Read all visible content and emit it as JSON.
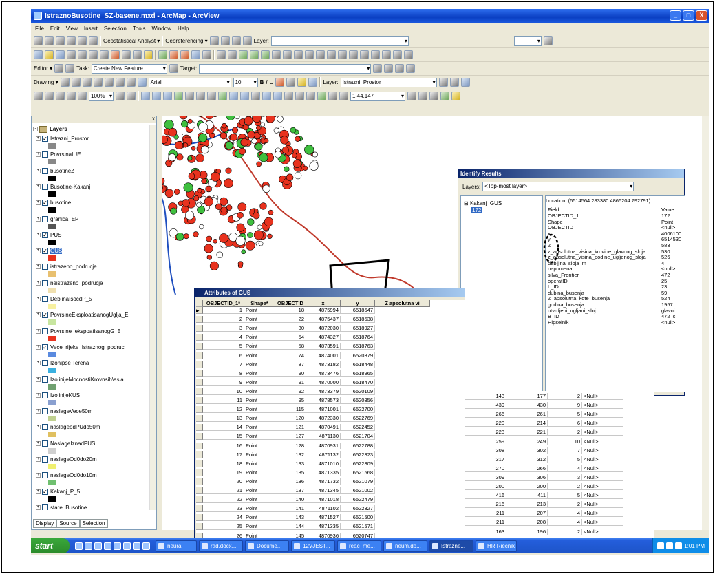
{
  "window": {
    "title": "IstraznoBusotine_SZ-basene.mxd - ArcMap - ArcView",
    "controls": [
      "_",
      "□",
      "X"
    ]
  },
  "menu": [
    "File",
    "Edit",
    "View",
    "Insert",
    "Selection",
    "Tools",
    "Window",
    "Help"
  ],
  "toolbar1": {
    "geostat": "Geostatistical Analyst ▾",
    "georef": "Georeferencing ▾",
    "layer_label": "Layer:"
  },
  "editor": {
    "label": "Editor ▾",
    "task_label": "Task:",
    "task_value": "Create New Feature",
    "target_label": "Target:"
  },
  "drawing": {
    "label": "Drawing ▾",
    "font": "Arial",
    "size": "10",
    "bold": "B",
    "italic": "I",
    "underline": "U",
    "layer_label": "Layer:",
    "layer_value": "Istrazni_Prostor"
  },
  "tools": {
    "scale": "1:44,147",
    "zoom": "100%"
  },
  "toc": {
    "root": "Layers",
    "layers": [
      {
        "name": "Istrazni_Prostor",
        "checked": true
      },
      {
        "name": "PovrsinaIUE",
        "checked": false
      },
      {
        "name": "busotineZ",
        "checked": false
      },
      {
        "name": "Busotine-Kakanj",
        "checked": false
      },
      {
        "name": "busotine",
        "checked": true
      },
      {
        "name": "granica_EP",
        "checked": false
      },
      {
        "name": "PUS",
        "checked": true
      },
      {
        "name": "GUS",
        "checked": true
      },
      {
        "name": "istrazeno_podrucje",
        "checked": false
      },
      {
        "name": "neistrazeno_podrucje",
        "checked": false
      },
      {
        "name": "DeblinaIsocdP_5",
        "checked": false
      },
      {
        "name": "PovrsineEksploatisanogUglja_E",
        "checked": true
      },
      {
        "name": "Povrsine_ekspoatisanogG_5",
        "checked": false
      },
      {
        "name": "Vece_rijeke_Istraznog_podruc",
        "checked": true
      },
      {
        "name": "Izohipse Terena",
        "checked": false
      },
      {
        "name": "IzolinijeMocnostiKrovnsih\\asla",
        "checked": false
      },
      {
        "name": "IzolinijeKUS",
        "checked": false
      },
      {
        "name": "naslageVece50m",
        "checked": false
      },
      {
        "name": "naslageodPUdo50m",
        "checked": false
      },
      {
        "name": "NaslageIznadPUS",
        "checked": false
      },
      {
        "name": "naslageOd0do20m",
        "checked": false
      },
      {
        "name": "naslageOd0do10m",
        "checked": false
      },
      {
        "name": "Kakanj_P_5",
        "checked": true
      },
      {
        "name": "stare_Busotine",
        "checked": false
      }
    ],
    "tabs": [
      "Display",
      "Source",
      "Selection"
    ]
  },
  "identify": {
    "title": "Identify Results",
    "layers_label": "Layers:",
    "layers_value": "<Top-most layer>",
    "tree_root": "Kakanj_GUS",
    "tree_child": "172",
    "location": "Location: (6514564.283380 4866204.792791)",
    "col_field": "Field",
    "col_value": "Value",
    "rows": [
      [
        "OBJECTID_1",
        "172"
      ],
      [
        "Shape",
        "Point"
      ],
      [
        "OBJECTID",
        "<null>"
      ],
      [
        "x",
        "4006100"
      ],
      [
        "y",
        "6514530"
      ],
      [
        "Z",
        "583"
      ],
      [
        "z_apsolutna_visina_krovine_glavnog_sloja",
        "530"
      ],
      [
        "z_apsolutna_visina_podine_ugljenog_sloja",
        "526"
      ],
      [
        "debljina_sloja_m",
        "4"
      ],
      [
        "napomena",
        "<null>"
      ],
      [
        "silva_Frontier",
        "472"
      ],
      [
        "operatID",
        "25"
      ],
      [
        "L_ID",
        "23"
      ],
      [
        "dubina_busenja",
        "59"
      ],
      [
        "Z_apsolutna_kote_busenja",
        "524"
      ],
      [
        "godina_busenja",
        "1957"
      ],
      [
        "utvrdjeni_ugljani_sloj",
        "glavni"
      ],
      [
        "B_ID",
        "472_c"
      ],
      [
        "Hipselnik",
        "<null>"
      ]
    ]
  },
  "attributes": {
    "title": "Attributes of GUS",
    "columns": [
      "OBJECTID_1*",
      "Shape*",
      "OBJECTID",
      "x",
      "y",
      "Z apsolutna vi"
    ],
    "extra_columns": [
      "",
      "",
      "",
      ""
    ],
    "rows": [
      [
        "1",
        "Point",
        "18",
        "4875994",
        "6518547"
      ],
      [
        "2",
        "Point",
        "22",
        "4875437",
        "6518538"
      ],
      [
        "3",
        "Point",
        "30",
        "4872030",
        "6518927"
      ],
      [
        "4",
        "Point",
        "54",
        "4874327",
        "6518764"
      ],
      [
        "5",
        "Point",
        "58",
        "4873591",
        "6518763"
      ],
      [
        "6",
        "Point",
        "74",
        "4874001",
        "6520379"
      ],
      [
        "7",
        "Point",
        "87",
        "4873182",
        "6518448"
      ],
      [
        "8",
        "Point",
        "90",
        "4873476",
        "6518965"
      ],
      [
        "9",
        "Point",
        "91",
        "4870000",
        "6518470"
      ],
      [
        "10",
        "Point",
        "92",
        "4873379",
        "6520109"
      ],
      [
        "11",
        "Point",
        "95",
        "4878573",
        "6520356",
        "143",
        "177",
        "2",
        "<Null>"
      ],
      [
        "12",
        "Point",
        "115",
        "4871001",
        "6522700",
        "439",
        "430",
        "9",
        "<Null>"
      ],
      [
        "13",
        "Point",
        "120",
        "4872330",
        "6522769",
        "266",
        "261",
        "5",
        "<Null>"
      ],
      [
        "14",
        "Point",
        "121",
        "4870491",
        "6522452",
        "220",
        "214",
        "6",
        "<Null>"
      ],
      [
        "15",
        "Point",
        "127",
        "4871130",
        "6521704",
        "223",
        "221",
        "2",
        "<Null>"
      ],
      [
        "16",
        "Point",
        "128",
        "4870931",
        "6522788",
        "259",
        "249",
        "10",
        "<Null>"
      ],
      [
        "17",
        "Point",
        "132",
        "4871132",
        "6522323",
        "308",
        "302",
        "7",
        "<Null>"
      ],
      [
        "18",
        "Point",
        "133",
        "4871010",
        "6522309",
        "317",
        "312",
        "5",
        "<Null>"
      ],
      [
        "19",
        "Point",
        "135",
        "4871335",
        "6521568",
        "270",
        "266",
        "4",
        "<Null>"
      ],
      [
        "20",
        "Point",
        "136",
        "4871732",
        "6521079",
        "309",
        "306",
        "3",
        "<Null>"
      ],
      [
        "21",
        "Point",
        "137",
        "4871345",
        "6521002",
        "200",
        "200",
        "2",
        "<Null>"
      ],
      [
        "22",
        "Point",
        "140",
        "4871018",
        "6522479",
        "416",
        "411",
        "5",
        "<Null>"
      ],
      [
        "23",
        "Point",
        "141",
        "4871102",
        "6522327",
        "216",
        "213",
        "2",
        "<Null>"
      ],
      [
        "24",
        "Point",
        "143",
        "4871527",
        "6521500",
        "211",
        "207",
        "4",
        "<Null>"
      ],
      [
        "25",
        "Point",
        "144",
        "4871335",
        "6521571",
        "211",
        "208",
        "4",
        "<Null>"
      ],
      [
        "26",
        "Point",
        "145",
        "4870936",
        "6520747",
        "163",
        "196",
        "2",
        "<Null>"
      ]
    ]
  },
  "taskbar": {
    "start": "start",
    "buttons": [
      "neura",
      "rad.docx...",
      "Docume...",
      "12VJEST...",
      "reac_me...",
      "neum.do...",
      "Istrazne...",
      "HR Riecnik"
    ],
    "time": "1:01 PM"
  },
  "colors": {
    "accent": "#0a246a",
    "map_points": "#e8321e",
    "river": "#c0392b",
    "boundary": "#1f4fbf"
  }
}
